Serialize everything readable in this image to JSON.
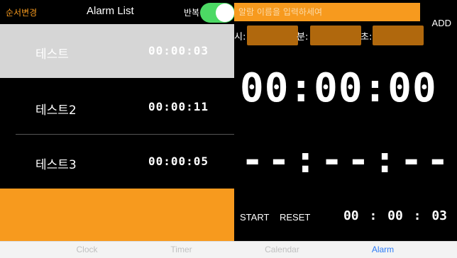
{
  "header": {
    "reorder_label": "순서변경",
    "title": "Alarm List",
    "repeat_label": "반복",
    "repeat_on": true
  },
  "alarms": [
    {
      "name": "테스트",
      "time": "00:00:03"
    },
    {
      "name": "테스트2",
      "time": "00:00:11"
    },
    {
      "name": "테스트3",
      "time": "00:00:05"
    }
  ],
  "form": {
    "name_placeholder": "알람 이름을 입력하세여",
    "add_label": "ADD",
    "hour_label": "시:",
    "minute_label": "분:",
    "second_label": "초:"
  },
  "display": {
    "main_time": "00:00:00",
    "idle_time": "--:--:--",
    "start_label": "START",
    "reset_label": "RESET",
    "selected_time": "00 : 00 : 03"
  },
  "tabs": [
    {
      "label": "Clock",
      "active": false
    },
    {
      "label": "Timer",
      "active": false
    },
    {
      "label": "Calendar",
      "active": false
    },
    {
      "label": "Alarm",
      "active": true
    }
  ],
  "colors": {
    "accent": "#f79a1e",
    "toggle_on": "#4cd964",
    "tab_active": "#2e7cf6"
  }
}
